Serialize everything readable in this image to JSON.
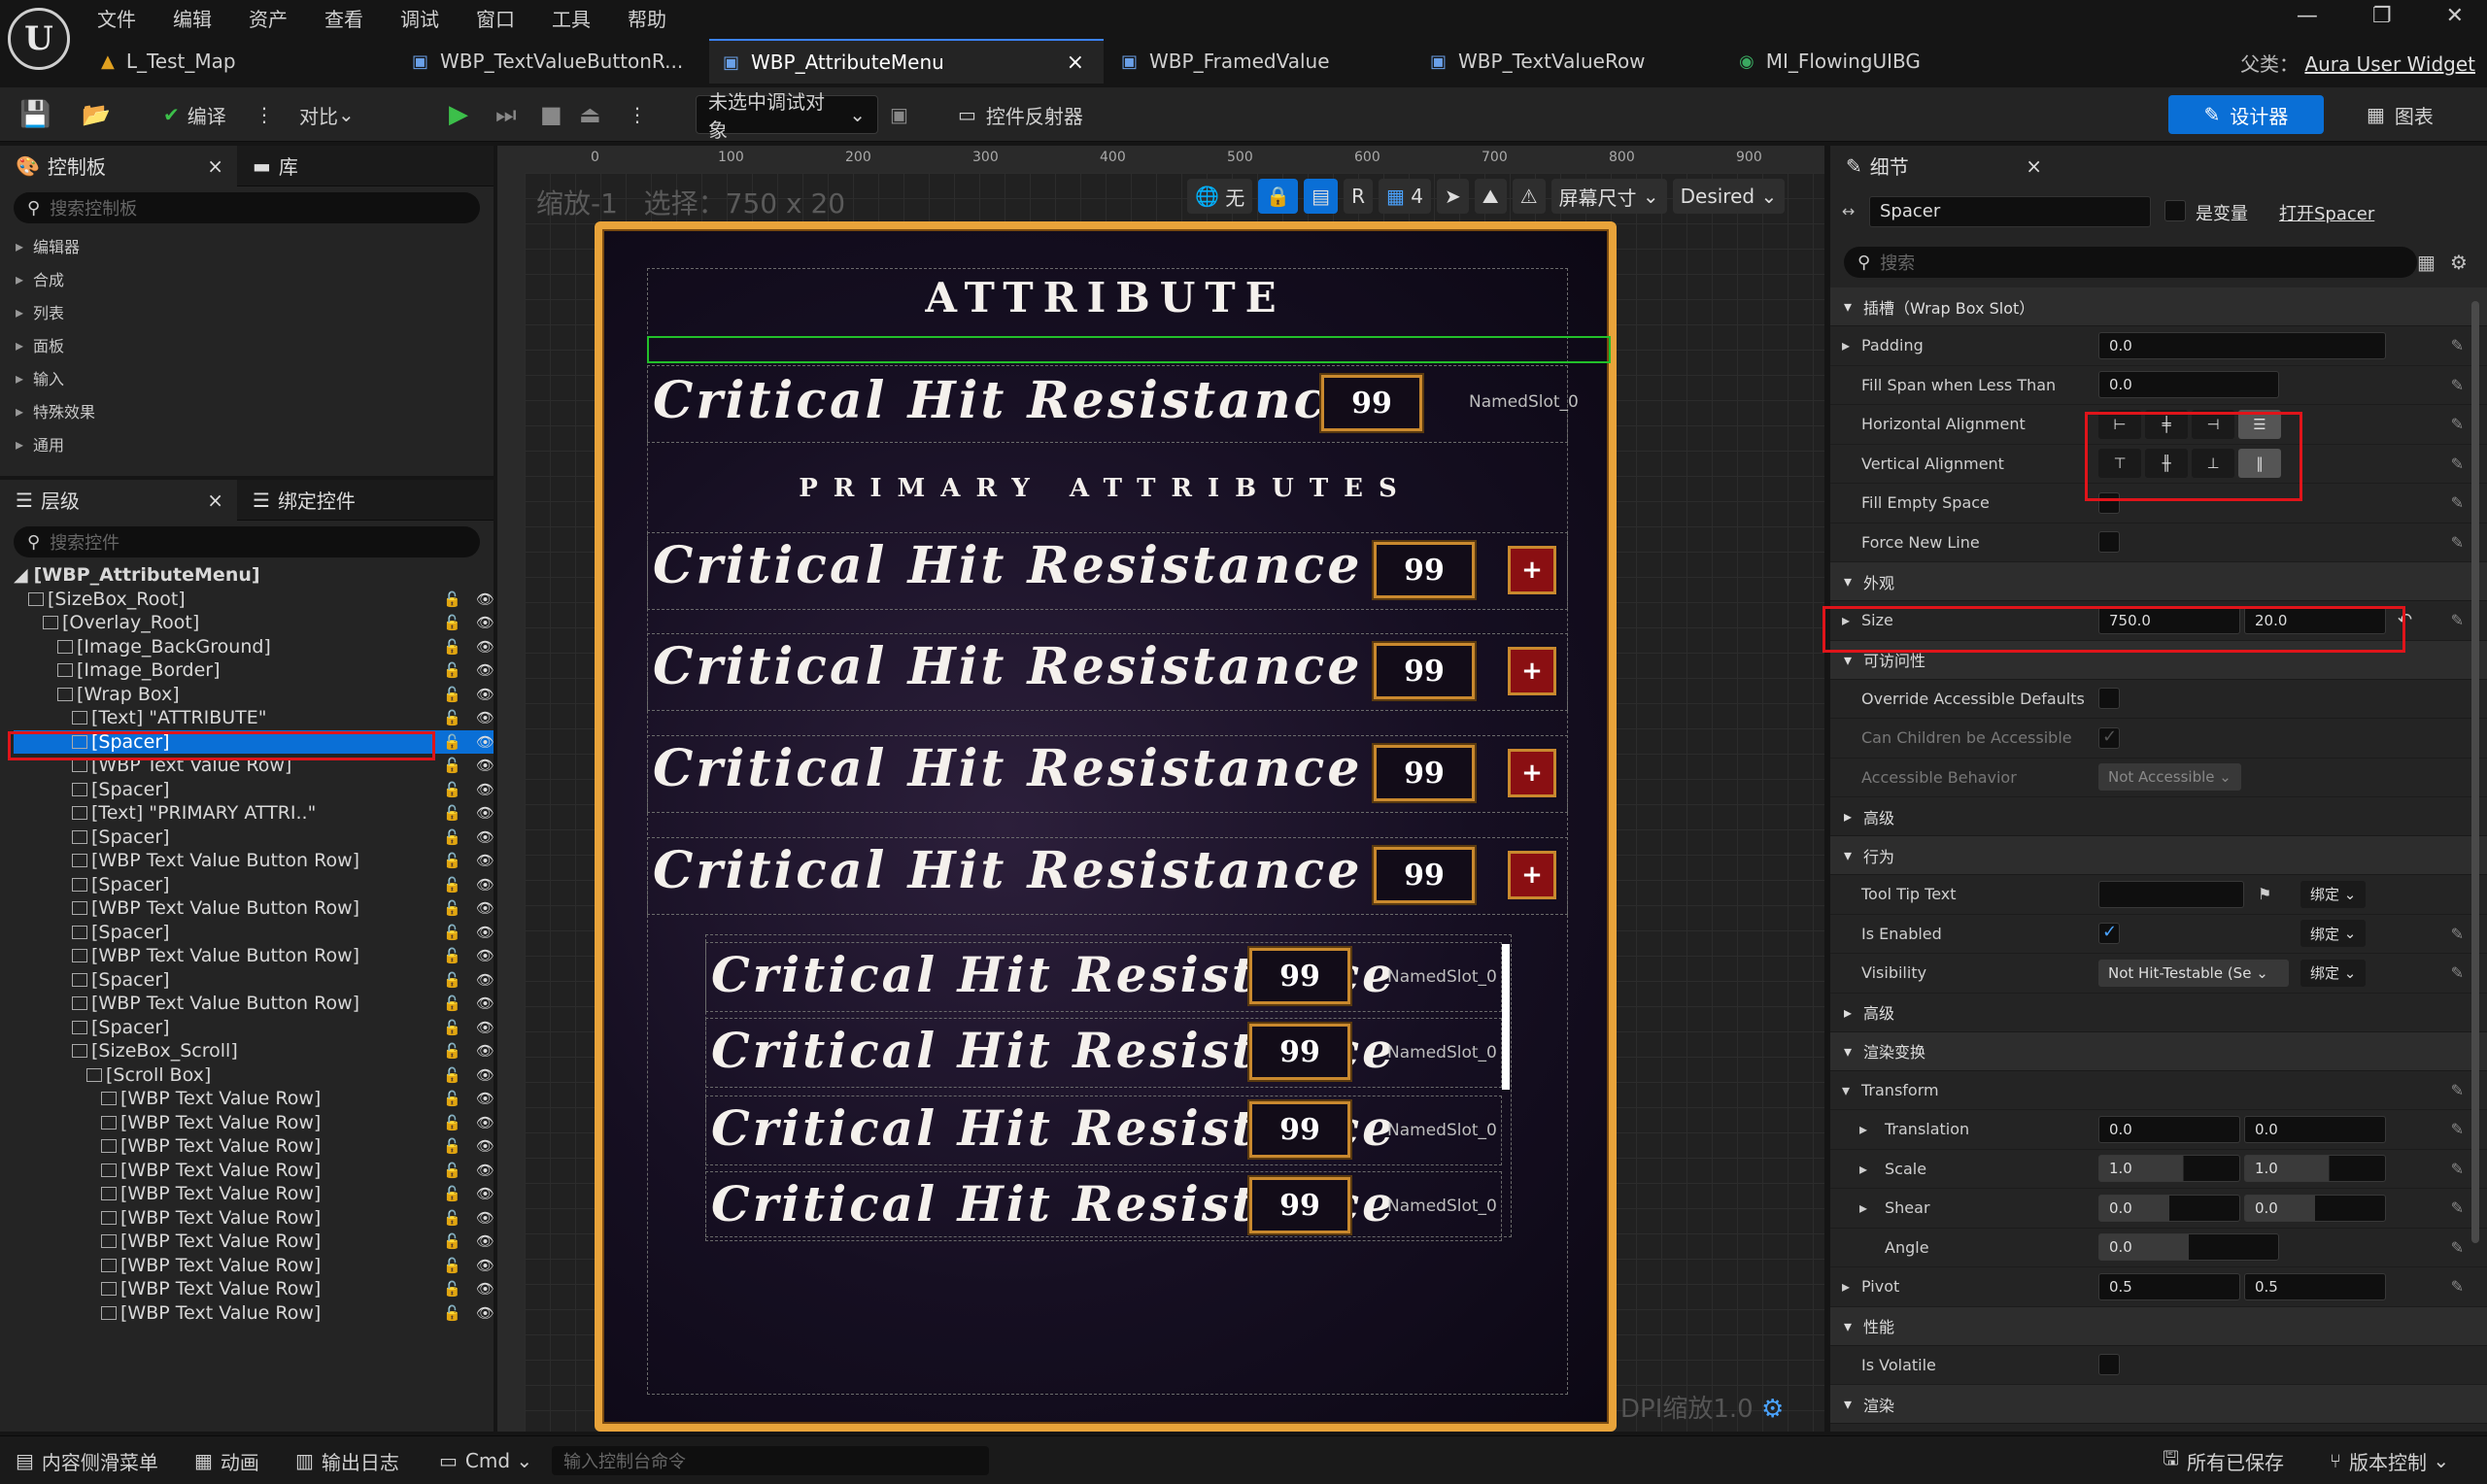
{
  "menubar": {
    "logo": "U",
    "items": [
      "文件",
      "编辑",
      "资产",
      "查看",
      "调试",
      "窗口",
      "工具",
      "帮助"
    ],
    "window_controls": [
      "—",
      "❐",
      "✕"
    ]
  },
  "tabs": [
    {
      "label": "L_Test_Map",
      "icon": "▲"
    },
    {
      "label": "WBP_TextValueButtonR...",
      "icon": "▣"
    },
    {
      "label": "WBP_AttributeMenu",
      "icon": "▣",
      "close": "×"
    },
    {
      "label": "WBP_FramedValue",
      "icon": "▣"
    },
    {
      "label": "WBP_TextValueRow",
      "icon": "▣"
    },
    {
      "label": "MI_FlowingUIBG",
      "icon": "◉"
    }
  ],
  "parent_class": {
    "label": "父类：",
    "value": "Aura User Widget"
  },
  "toolbar": {
    "compile": "编译",
    "diff": "对比",
    "debug_target": "未选中调试对象",
    "reflector": "控件反射器",
    "designer": "设计器",
    "graph": "图表"
  },
  "palette": {
    "tabs": [
      "控制板",
      "库"
    ],
    "search_placeholder": "搜索控制板",
    "categories": [
      "编辑器",
      "合成",
      "列表",
      "面板",
      "输入",
      "特殊效果",
      "通用"
    ]
  },
  "hierarchy": {
    "tabs": [
      "层级",
      "绑定控件"
    ],
    "search_placeholder": "搜索控件",
    "root": "[WBP_AttributeMenu]",
    "items": [
      {
        "indent": 1,
        "label": "[SizeBox_Root]"
      },
      {
        "indent": 2,
        "label": "[Overlay_Root]"
      },
      {
        "indent": 3,
        "label": "[Image_BackGround]"
      },
      {
        "indent": 3,
        "label": "[Image_Border]"
      },
      {
        "indent": 3,
        "label": "[Wrap Box]"
      },
      {
        "indent": 4,
        "label": "[Text] \"ATTRIBUTE\""
      },
      {
        "indent": 4,
        "label": "[Spacer]",
        "selected": true
      },
      {
        "indent": 4,
        "label": "[WBP Text Value Row]"
      },
      {
        "indent": 4,
        "label": "[Spacer]"
      },
      {
        "indent": 4,
        "label": "[Text] \"PRIMARY ATTRI..\""
      },
      {
        "indent": 4,
        "label": "[Spacer]"
      },
      {
        "indent": 4,
        "label": "[WBP Text Value Button Row]"
      },
      {
        "indent": 4,
        "label": "[Spacer]"
      },
      {
        "indent": 4,
        "label": "[WBP Text Value Button Row]"
      },
      {
        "indent": 4,
        "label": "[Spacer]"
      },
      {
        "indent": 4,
        "label": "[WBP Text Value Button Row]"
      },
      {
        "indent": 4,
        "label": "[Spacer]"
      },
      {
        "indent": 4,
        "label": "[WBP Text Value Button Row]"
      },
      {
        "indent": 4,
        "label": "[Spacer]"
      },
      {
        "indent": 4,
        "label": "[SizeBox_Scroll]"
      },
      {
        "indent": 5,
        "label": "[Scroll Box]"
      },
      {
        "indent": 6,
        "label": "[WBP Text Value Row]"
      },
      {
        "indent": 6,
        "label": "[WBP Text Value Row]"
      },
      {
        "indent": 6,
        "label": "[WBP Text Value Row]"
      },
      {
        "indent": 6,
        "label": "[WBP Text Value Row]"
      },
      {
        "indent": 6,
        "label": "[WBP Text Value Row]"
      },
      {
        "indent": 6,
        "label": "[WBP Text Value Row]"
      },
      {
        "indent": 6,
        "label": "[WBP Text Value Row]"
      },
      {
        "indent": 6,
        "label": "[WBP Text Value Row]"
      },
      {
        "indent": 6,
        "label": "[WBP Text Value Row]"
      },
      {
        "indent": 6,
        "label": "[WBP Text Value Row]"
      }
    ]
  },
  "viewport": {
    "zoom": "缩放-1",
    "selection": "选择：750 x 20",
    "ruler_marks": [
      "0",
      "100",
      "200",
      "300",
      "400",
      "500",
      "600",
      "700",
      "800",
      "900"
    ],
    "tools": {
      "none": "无",
      "r": "R",
      "grid": "4",
      "screen": "屏幕尺寸",
      "desired": "Desired"
    },
    "dpi": "DPI缩放1.0"
  },
  "menu": {
    "title": "ATTRIBUTE",
    "subtitle": "PRIMARY ATTRIBUTES",
    "row_label": "Critical Hit Resistance",
    "value": "99",
    "plus": "+",
    "slot": "NamedSlot_0"
  },
  "details": {
    "tab": "细节",
    "widget_name": "Spacer",
    "is_variable": "是变量",
    "open_link": "打开Spacer",
    "search_placeholder": "搜索",
    "sections": {
      "slot": "插槽（Wrap Box Slot）",
      "appearance": "外观",
      "accessibility": "可访问性",
      "advanced": "高级",
      "behavior": "行为",
      "advanced2": "高级",
      "render_transform": "渲染变换",
      "performance": "性能",
      "render": "渲染"
    },
    "padding": {
      "label": "Padding",
      "value": "0.0"
    },
    "fill_span": {
      "label": "Fill Span when Less Than",
      "value": "0.0"
    },
    "h_align": {
      "label": "Horizontal Alignment"
    },
    "v_align": {
      "label": "Vertical Alignment"
    },
    "fill_empty": {
      "label": "Fill Empty Space"
    },
    "force_new_line": {
      "label": "Force New Line"
    },
    "size": {
      "label": "Size",
      "x": "750.0",
      "y": "20.0"
    },
    "override_access": {
      "label": "Override Accessible Defaults"
    },
    "children_access": {
      "label": "Can Children be Accessible"
    },
    "access_behavior": {
      "label": "Accessible Behavior",
      "value": "Not Accessible"
    },
    "tooltip": {
      "label": "Tool Tip Text",
      "bind": "绑定"
    },
    "is_enabled": {
      "label": "Is Enabled",
      "bind": "绑定"
    },
    "visibility": {
      "label": "Visibility",
      "value": "Not Hit-Testable (Se",
      "bind": "绑定"
    },
    "transform": {
      "label": "Transform"
    },
    "translation": {
      "label": "Translation",
      "x": "0.0",
      "y": "0.0"
    },
    "scale": {
      "label": "Scale",
      "x": "1.0",
      "y": "1.0"
    },
    "shear": {
      "label": "Shear",
      "x": "0.0",
      "y": "0.0"
    },
    "angle": {
      "label": "Angle",
      "value": "0.0"
    },
    "pivot": {
      "label": "Pivot",
      "x": "0.5",
      "y": "0.5"
    },
    "is_volatile": {
      "label": "Is Volatile"
    }
  },
  "statusbar": {
    "drawer": "内容侧滑菜单",
    "anim": "动画",
    "log": "输出日志",
    "cmd": "Cmd",
    "cmd_placeholder": "输入控制台命令",
    "saved": "所有已保存",
    "vcs": "版本控制"
  }
}
